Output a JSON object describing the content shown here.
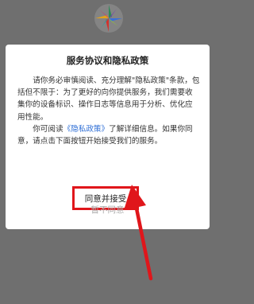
{
  "dialog": {
    "title": "服务协议和隐私政策",
    "para1": "请你务必审慎阅读、充分理解\"隐私政策\"条款，包括但不限于：为了更好的向你提供服务，我们需要收集你的设备标识、操作日志等信息用于分析、优化应用性能。",
    "para2_prefix": "你可阅读",
    "para2_link": "《隐私政策》",
    "para2_suffix": "了解详细信息。如果你同意，请点击下面按钮开始接受我们的服务。",
    "agree_button": "同意并接受",
    "disagree_button": "暂不同意"
  },
  "colors": {
    "overlay": "#6f6f6f",
    "link": "#2f6fd6",
    "highlight": "#e0161b",
    "disagree_text": "#aaaaaa"
  },
  "icons": {
    "logo": "app-logo-icon",
    "arrow": "red-arrow-annotation-icon"
  }
}
